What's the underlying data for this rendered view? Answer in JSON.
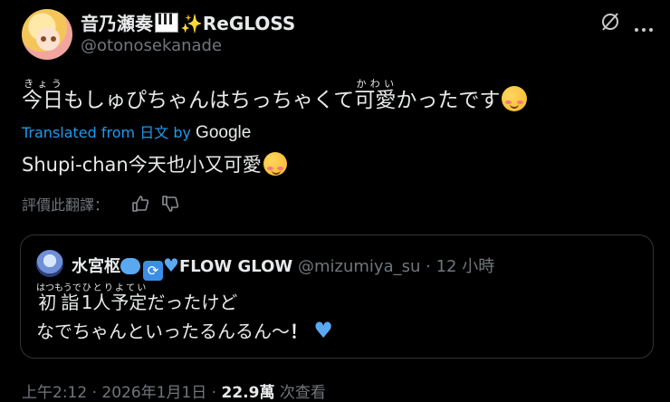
{
  "author": {
    "display_name": "音乃瀬奏",
    "display_suffix": "ReGLOSS",
    "handle": "@otonosekanade"
  },
  "tweet": {
    "segments": [
      {
        "text": "今日",
        "ruby": "きょう"
      },
      {
        "text": "もしゅぴちゃんはちっちゃくて"
      },
      {
        "text": "可愛",
        "ruby": "かわい"
      },
      {
        "text": "かったです"
      }
    ],
    "translated_prefix": "Translated from",
    "translated_lang": "日文",
    "translated_by": "by",
    "translated_engine": "Google",
    "translation": "Shupi-chan今天也小又可愛",
    "rate_label": "評價此翻譯："
  },
  "quote": {
    "name": "水宮枢",
    "name_suffix": "FLOW GLOW",
    "handle": "@mizumiya_su",
    "separator": "·",
    "time_ago": "12 小時",
    "line1_ruby_text": "初詣",
    "line1_ruby": "はつもうで",
    "line1_ruby2_text": "1人予定",
    "line1_ruby2": "ひとりよてい",
    "line1_rest": "だったけど",
    "line2": "なでちゃんといったるんるん〜",
    "line2_exclaim": "！"
  },
  "footer": {
    "time": "上午2:12 · 2026年1月1日 · ",
    "views": "22.9萬",
    "views_label": " 次查看"
  },
  "colors": {
    "link": "#1d9bf0",
    "muted": "#71767b",
    "text": "#e7e9ea",
    "border": "#2f3336"
  }
}
